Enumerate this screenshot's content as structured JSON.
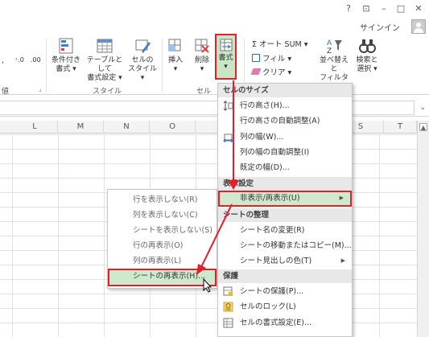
{
  "window": {
    "help": "?",
    "ribbon_display": "⊡",
    "minimize": "–",
    "maximize": "□",
    "close": "✕",
    "signin": "サインイン"
  },
  "ribbon": {
    "comma": ",",
    "decimal_inc": "⁺.0",
    "decimal_dec": ".00",
    "cond_format": [
      "条件付き",
      "書式 ▾"
    ],
    "table_format": [
      "テーブルとして",
      "書式設定 ▾"
    ],
    "cell_style": [
      "セルの",
      "スタイル ▾"
    ],
    "insert": [
      "挿入",
      "▾"
    ],
    "delete": [
      "削除",
      "▾"
    ],
    "format": [
      "書式",
      "▾"
    ],
    "autosum": "Σ オート SUM ▾",
    "fill": "フィル ▾",
    "clear": "クリア ▾",
    "sort_filter": [
      "並べ替えと",
      "フィルター ▾"
    ],
    "find_select": [
      "検索と",
      "選択 ▾"
    ],
    "group_number_tail": "値",
    "group_style": "スタイル",
    "group_cell": "セル",
    "launcher": "⌟"
  },
  "formula_bar": {
    "dropdown": "⌄"
  },
  "columns": [
    "L",
    "M",
    "N",
    "O",
    "S",
    "T"
  ],
  "format_menu": {
    "section_size": "セルのサイズ",
    "row_height": "行の高さ(H)...",
    "autofit_row": "行の高さの自動調整(A)",
    "col_width": "列の幅(W)...",
    "autofit_col": "列の幅の自動調整(I)",
    "default_width": "既定の幅(D)...",
    "section_visibility": "表示設定",
    "hide_unhide": "非表示/再表示(U)",
    "section_organize": "シートの整理",
    "rename_sheet": "シート名の変更(R)",
    "move_copy": "シートの移動またはコピー(M)...",
    "tab_color": "シート見出しの色(T)",
    "section_protect": "保護",
    "protect_sheet": "シートの保護(P)...",
    "lock_cell": "セルのロック(L)",
    "format_cells": "セルの書式設定(E)..."
  },
  "submenu": {
    "hide_rows": "行を表示しない(R)",
    "hide_cols": "列を表示しない(C)",
    "hide_sheet": "シートを表示しない(S)",
    "unhide_rows": "行の再表示(O)",
    "unhide_cols": "列の再表示(L)",
    "unhide_sheet": "シートの再表示(H)..."
  },
  "colors": {
    "highlight": "#cfe9cf",
    "red": "#e0202a",
    "accent_green": "#217346"
  }
}
